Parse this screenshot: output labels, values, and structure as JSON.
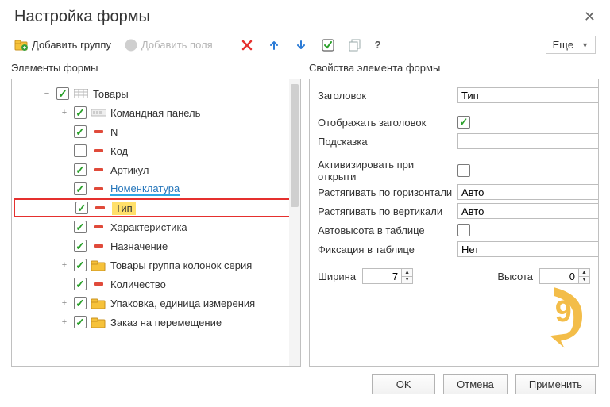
{
  "window": {
    "title": "Настройка формы"
  },
  "toolbar": {
    "add_group": "Добавить группу",
    "add_fields": "Добавить поля",
    "more": "Еще"
  },
  "left": {
    "title": "Элементы формы",
    "items": [
      {
        "depth": 0,
        "expand": "−",
        "checked": true,
        "icon": "grid",
        "label": "Товары"
      },
      {
        "depth": 1,
        "expand": "+",
        "checked": true,
        "icon": "panel",
        "label": "Командная панель"
      },
      {
        "depth": 1,
        "expand": "",
        "checked": true,
        "icon": "minus",
        "label": "N"
      },
      {
        "depth": 1,
        "expand": "",
        "checked": false,
        "icon": "minus",
        "label": "Код"
      },
      {
        "depth": 1,
        "expand": "",
        "checked": true,
        "icon": "minus",
        "label": "Артикул"
      },
      {
        "depth": 1,
        "expand": "",
        "checked": true,
        "icon": "minus",
        "label": "Номенклатура",
        "link": true
      },
      {
        "depth": 1,
        "expand": "",
        "checked": true,
        "icon": "minus",
        "label": "Тип",
        "highlight": true
      },
      {
        "depth": 1,
        "expand": "",
        "checked": true,
        "icon": "minus",
        "label": "Характеристика"
      },
      {
        "depth": 1,
        "expand": "",
        "checked": true,
        "icon": "minus",
        "label": "Назначение"
      },
      {
        "depth": 1,
        "expand": "+",
        "checked": true,
        "icon": "folder",
        "label": "Товары группа колонок серия"
      },
      {
        "depth": 1,
        "expand": "",
        "checked": true,
        "icon": "minus",
        "label": "Количество"
      },
      {
        "depth": 1,
        "expand": "+",
        "checked": true,
        "icon": "folder",
        "label": "Упаковка, единица измерения"
      },
      {
        "depth": 1,
        "expand": "+",
        "checked": true,
        "icon": "folder",
        "label": "Заказ на перемещение"
      }
    ]
  },
  "right": {
    "title": "Свойства элемента формы",
    "fields": {
      "title_label": "Заголовок",
      "title_value": "Тип",
      "show_title_label": "Отображать заголовок",
      "show_title_checked": true,
      "hint_label": "Подсказка",
      "hint_value": "",
      "activate_label": "Активизировать при открыти",
      "activate_checked": false,
      "stretch_h_label": "Растягивать по горизонтали",
      "stretch_h_value": "Авто",
      "stretch_v_label": "Растягивать по вертикали",
      "stretch_v_value": "Авто",
      "auto_height_label": "Автовысота в таблице",
      "auto_height_checked": false,
      "fixation_label": "Фиксация в таблице",
      "fixation_value": "Нет",
      "width_label": "Ширина",
      "width_value": "7",
      "height_label": "Высота",
      "height_value": "0"
    }
  },
  "footer": {
    "ok": "OK",
    "cancel": "Отмена",
    "apply": "Применить"
  }
}
